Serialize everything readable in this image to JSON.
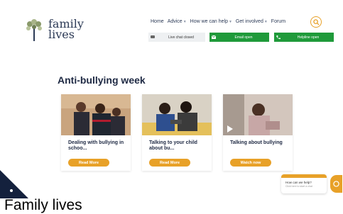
{
  "brand": {
    "line1": "family",
    "line2": "lives"
  },
  "nav": {
    "items": [
      {
        "label": "Home",
        "dropdown": false
      },
      {
        "label": "Advice",
        "dropdown": true
      },
      {
        "label": "How we can help",
        "dropdown": true
      },
      {
        "label": "Get involved",
        "dropdown": true
      },
      {
        "label": "Forum",
        "dropdown": false
      }
    ]
  },
  "contact": {
    "live_chat": "Live chat closed",
    "email": "Email open",
    "helpline": "Helpline open"
  },
  "section": {
    "heading": "Anti-bullying week"
  },
  "cards": [
    {
      "title": "Dealing with bullying in schoo...",
      "cta": "Read More"
    },
    {
      "title": "Talking to your child about bu...",
      "cta": "Read More"
    },
    {
      "title": "Talking about bullying",
      "cta": "Watch now"
    }
  ],
  "help_widget": {
    "line1": "How can we help?",
    "line2": "Click here to start a chat"
  },
  "caption": "Family lives",
  "colors": {
    "accent": "#e8a128",
    "green": "#1f9a3a",
    "navy": "#14213d"
  }
}
